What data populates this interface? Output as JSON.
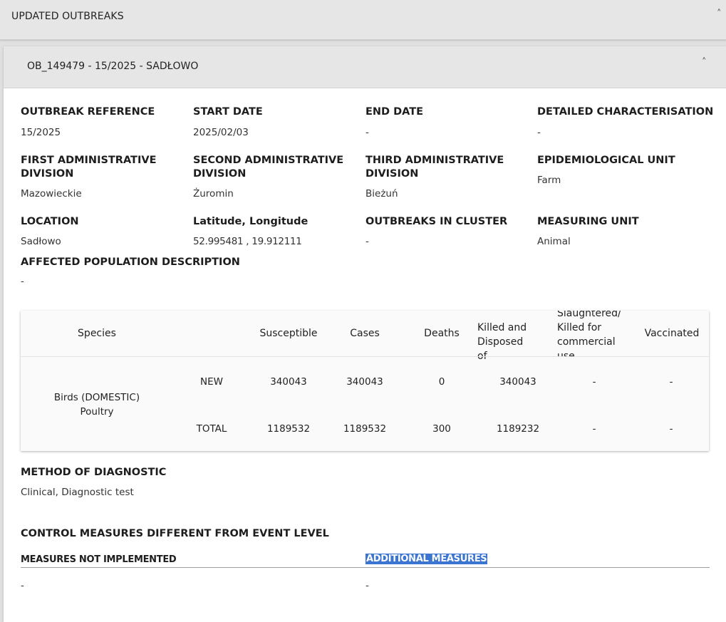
{
  "section": {
    "title": "UPDATED OUTBREAKS",
    "chevron_icon": "chevron-up-icon"
  },
  "outbreak": {
    "title": "OB_149479 - 15/2025 - SADŁOWO",
    "chevron_icon": "chevron-up-icon",
    "fields": {
      "outbreak_reference": {
        "label": "OUTBREAK REFERENCE",
        "value": "15/2025"
      },
      "start_date": {
        "label": "START DATE",
        "value": "2025/02/03"
      },
      "end_date": {
        "label": "END DATE",
        "value": "-"
      },
      "detailed_characterisation": {
        "label": "DETAILED CHARACTERISATION",
        "value": "-"
      },
      "first_admin": {
        "label_line1": "FIRST ADMINISTRATIVE",
        "label_line2": "DIVISION",
        "value": "Mazowieckie"
      },
      "second_admin": {
        "label_line1": "SECOND ADMINISTRATIVE",
        "label_line2": "DIVISION",
        "value": "Żuromin"
      },
      "third_admin": {
        "label_line1": "THIRD ADMINISTRATIVE",
        "label_line2": "DIVISION",
        "value": "Bieżuń"
      },
      "epi_unit": {
        "label": "EPIDEMIOLOGICAL UNIT",
        "value": "Farm"
      },
      "location": {
        "label": "LOCATION",
        "value": "Sadłowo"
      },
      "lat_long": {
        "label": "Latitude, Longitude",
        "value": "52.995481 , 19.912111"
      },
      "outbreaks_in_cluster": {
        "label": "OUTBREAKS IN CLUSTER",
        "value": "-"
      },
      "measuring_unit": {
        "label": "MEASURING UNIT",
        "value": "Animal"
      },
      "affected_population": {
        "label": "AFFECTED POPULATION DESCRIPTION",
        "value": "-"
      }
    },
    "table": {
      "headers": {
        "species": "Species",
        "susceptible": "Susceptible",
        "cases": "Cases",
        "deaths": "Deaths",
        "killed_line1": "Killed and",
        "killed_line2": "Disposed of",
        "slaughtered_line1": "Slaughtered/",
        "slaughtered_line2": "Killed for",
        "slaughtered_line3": "commercial",
        "slaughtered_line4": "use",
        "vaccinated": "Vaccinated"
      },
      "species_line1": "Birds (DOMESTIC)",
      "species_line2": "Poultry",
      "rows": [
        {
          "label": "NEW",
          "susceptible": "340043",
          "cases": "340043",
          "deaths": "0",
          "killed": "340043",
          "slaughtered": "-",
          "vaccinated": "-"
        },
        {
          "label": "TOTAL",
          "susceptible": "1189532",
          "cases": "1189532",
          "deaths": "300",
          "killed": "1189232",
          "slaughtered": "-",
          "vaccinated": "-"
        }
      ]
    },
    "method_of_diagnostic": {
      "label": "METHOD OF DIAGNOSTIC",
      "value": "Clinical, Diagnostic test"
    },
    "control_measures": {
      "title": "CONTROL MEASURES DIFFERENT FROM EVENT LEVEL",
      "not_implemented_label": "MEASURES NOT IMPLEMENTED",
      "not_implemented_value": "-",
      "additional_label": "ADDITIONAL MEASURES",
      "additional_value": "-"
    }
  },
  "colors": {
    "highlight": "#3b75d1",
    "header_bg": "#e6e6e6"
  }
}
